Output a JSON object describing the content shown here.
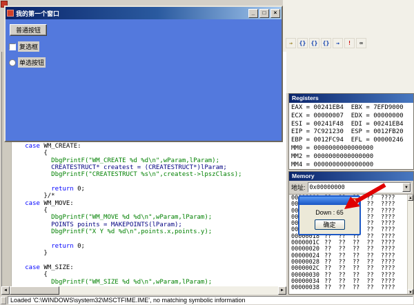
{
  "app": {
    "status_text": "Loaded 'C:\\WINDOWS\\system32\\MSCTFIME.IME', no matching symbolic information",
    "bg_color": "#d4d0c8"
  },
  "toolbar": {
    "icons": [
      {
        "name": "show-next-statement-icon",
        "glyph": "⇒",
        "color": "#8a6d00"
      },
      {
        "name": "step-into-icon",
        "glyph": "{}",
        "color": "#0033aa"
      },
      {
        "name": "step-over-icon",
        "glyph": "{}",
        "color": "#0033aa"
      },
      {
        "name": "step-out-icon",
        "glyph": "{}",
        "color": "#0033aa"
      },
      {
        "name": "run-to-cursor-icon",
        "glyph": "→",
        "color": "#0033aa"
      },
      {
        "name": "go-icon",
        "glyph": "!",
        "color": "#cc0000"
      },
      {
        "name": "quick-watch-icon",
        "glyph": "∞",
        "color": "#444444"
      }
    ]
  },
  "blue_window": {
    "title": "我的第一个窗口",
    "client_color": "#5379dd",
    "button_label": "普通按钮",
    "checkbox_label": "复选框",
    "radio_label": "单选按钮",
    "minimize_glyph": "_",
    "maximize_glyph": "□",
    "close_glyph": "×"
  },
  "registers": {
    "title": "Registers",
    "lines": [
      "EAX = 00241EB4  EBX = 7EFD9000",
      "ECX = 00000007  EDX = 00000000",
      "ESI = 00241F48  EDI = 00241EB4",
      "EIP = 7C921230  ESP = 0012FB20",
      "EBP = 0012FC94  EFL = 00000246",
      "MM0 = 0000000000000000",
      "MM2 = 0000000000000000",
      "MM4 = 0000000000000000"
    ]
  },
  "memory": {
    "title": "Memory",
    "address_label": "地址:",
    "address_value": "0x00000000",
    "dropdown_glyph": "▼",
    "rows": [
      {
        "addr": "00000000",
        "bytes": "??  ??  ??  ??",
        "ascii": "????"
      },
      {
        "addr": "00000004",
        "bytes": "??  ??  ??  ??",
        "ascii": "????"
      },
      {
        "addr": "00000008",
        "bytes": "??  ??  ??  ??",
        "ascii": "????"
      },
      {
        "addr": "0000000C",
        "bytes": "??  ??  ??  ??",
        "ascii": "????"
      },
      {
        "addr": "00000010",
        "bytes": "??  ??  ??  ??",
        "ascii": "????"
      },
      {
        "addr": "00000014",
        "bytes": "??  ??  ??  ??",
        "ascii": "????"
      },
      {
        "addr": "00000018",
        "bytes": "??  ??  ??  ??",
        "ascii": "????"
      },
      {
        "addr": "0000001C",
        "bytes": "??  ??  ??  ??",
        "ascii": "????"
      },
      {
        "addr": "00000020",
        "bytes": "??  ??  ??  ??",
        "ascii": "????"
      },
      {
        "addr": "00000024",
        "bytes": "??  ??  ??  ??",
        "ascii": "????"
      },
      {
        "addr": "00000028",
        "bytes": "??  ??  ??  ??",
        "ascii": "????"
      },
      {
        "addr": "0000002C",
        "bytes": "??  ??  ??  ??",
        "ascii": "????"
      },
      {
        "addr": "00000030",
        "bytes": "??  ??  ??  ??",
        "ascii": "????"
      },
      {
        "addr": "00000034",
        "bytes": "??  ??  ??  ??",
        "ascii": "????"
      },
      {
        "addr": "00000038",
        "bytes": "??  ??  ??  ??",
        "ascii": "????"
      }
    ]
  },
  "dialog": {
    "message": "Down : 65",
    "ok_label": "确定",
    "close_glyph": "×"
  },
  "code": {
    "lines": [
      [
        [
          "p",
          "   "
        ],
        [
          "k",
          "case"
        ],
        [
          "p",
          " WM_CREATE:"
        ]
      ],
      [
        [
          "p",
          "        {"
        ]
      ],
      [
        [
          "g",
          "          DbgPrintF(\"WM_CREATE %d %d\\n\",wParam,lParam);"
        ]
      ],
      [
        [
          "n",
          "          CREATESTRUCT* createst = (CREATESTRUCT*)lParam;"
        ]
      ],
      [
        [
          "g",
          "          DbgPrintF(\"CREATESTRUCT %s\\n\",createst->lpszClass);"
        ]
      ],
      [
        [
          "p",
          ""
        ]
      ],
      [
        [
          "p",
          "          "
        ],
        [
          "k",
          "return"
        ],
        [
          "p",
          " 0;"
        ]
      ],
      [
        [
          "p",
          "        }/*"
        ]
      ],
      [
        [
          "p",
          "   "
        ],
        [
          "k",
          "case"
        ],
        [
          "p",
          " WM_MOVE:"
        ]
      ],
      [
        [
          "p",
          "        {"
        ]
      ],
      [
        [
          "g",
          "          DbgPrintF(\"WM_MOVE %d %d\\n\",wParam,lParam);"
        ]
      ],
      [
        [
          "n",
          "          POINTS points = MAKEPOINTS(lParam);"
        ]
      ],
      [
        [
          "g",
          "          DbgPrintF(\"X Y %d %d\\n\",points.x,points.y);"
        ]
      ],
      [
        [
          "p",
          ""
        ]
      ],
      [
        [
          "p",
          "          "
        ],
        [
          "k",
          "return"
        ],
        [
          "p",
          " 0;"
        ]
      ],
      [
        [
          "p",
          "        }"
        ]
      ],
      [
        [
          "p",
          ""
        ]
      ],
      [
        [
          "p",
          "   "
        ],
        [
          "k",
          "case"
        ],
        [
          "p",
          " WM_SIZE:"
        ]
      ],
      [
        [
          "p",
          "        {"
        ]
      ],
      [
        [
          "g",
          "          DbgPrintF(\"WM_SIZE %d %d\\n\",wParam,lParam);"
        ]
      ]
    ]
  }
}
